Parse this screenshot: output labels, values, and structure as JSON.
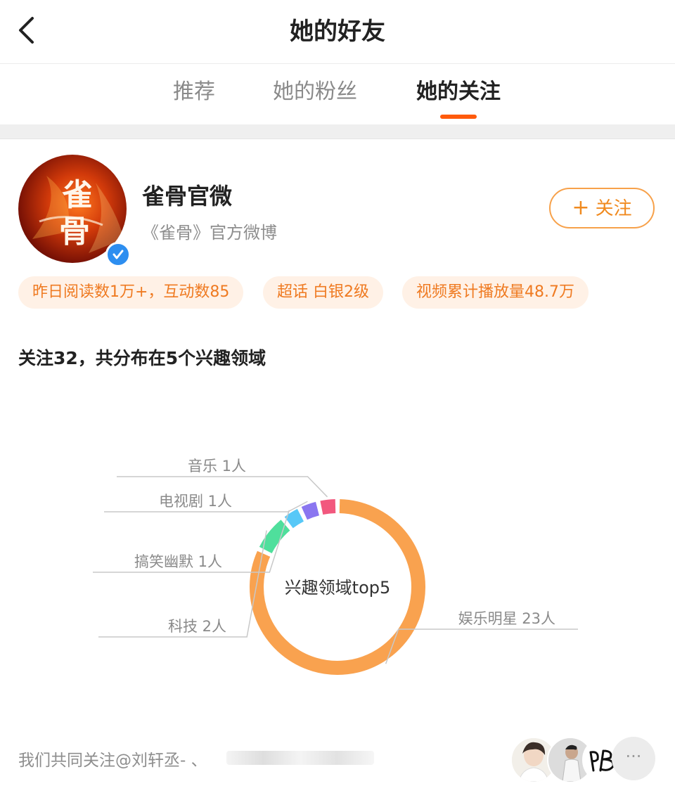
{
  "nav": {
    "title": "她的好友"
  },
  "tabs": [
    {
      "label": "推荐"
    },
    {
      "label": "她的粉丝"
    },
    {
      "label": "她的关注"
    }
  ],
  "profile": {
    "name": "雀骨官微",
    "description": "《雀骨》官方微博",
    "follow_button": {
      "icon": "+",
      "label": "关注"
    },
    "avatar_text": "雀骨"
  },
  "badges": [
    "昨日阅读数1万+，互动数85",
    "超话 白银2级",
    "视频累计播放量48.7万"
  ],
  "summary": "关注32，共分布在5个兴趣领域",
  "chart_data": {
    "type": "pie",
    "center_label": "兴趣领域top5",
    "slices": [
      {
        "label": "娱乐明星",
        "value": 23,
        "value_text": "23人",
        "color": "#f9a24f"
      },
      {
        "label": "科技",
        "value": 2,
        "value_text": "2人",
        "color": "#4fdf9c"
      },
      {
        "label": "搞笑幽默",
        "value": 1,
        "value_text": "1人",
        "color": "#57c8f7"
      },
      {
        "label": "电视剧",
        "value": 1,
        "value_text": "1人",
        "color": "#8a76f0"
      },
      {
        "label": "音乐",
        "value": 1,
        "value_text": "1人",
        "color": "#f2587e"
      }
    ]
  },
  "footer": {
    "common_follow_text": "我们共同关注@刘轩丞- 、",
    "more_icon": "···"
  },
  "colors": {
    "accent": "#ff5a0c",
    "follow": "#f08a1f",
    "badge_bg": "#fff1e6",
    "verified": "#2d8ef0"
  }
}
